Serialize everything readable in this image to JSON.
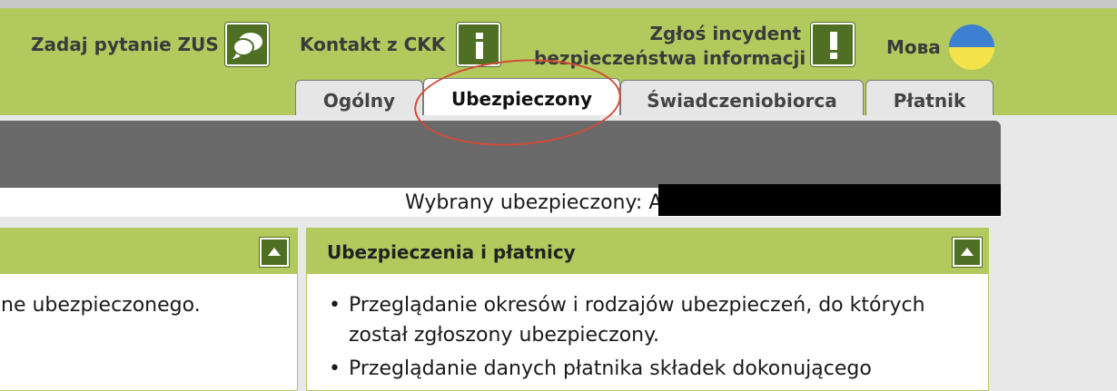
{
  "header": {
    "ask_zus": "Zadaj pytanie ZUS",
    "contact_ckk": "Kontakt z CKK",
    "report_line1": "Zgłoś incydent",
    "report_line2": "bezpieczeństwa informacji",
    "language": "Мова",
    "icons": [
      "chat-icon",
      "info-icon",
      "exclamation-icon",
      "ukraine-flag-icon"
    ]
  },
  "tabs": [
    {
      "label": "Ogólny",
      "active": false
    },
    {
      "label": "Ubezpieczony",
      "active": true
    },
    {
      "label": "Świadczeniobiorca",
      "active": false
    },
    {
      "label": "Płatnik",
      "active": false
    }
  ],
  "selected": {
    "label": "Wybrany ubezpieczony:",
    "value_visible": "A"
  },
  "left_panel": {
    "text": "ne ubezpieczonego."
  },
  "right_panel": {
    "title": "Ubezpieczenia i płatnicy",
    "items": [
      "Przeglądanie okresów i rodzajów ubezpieczeń, do których został zgłoszony ubezpieczony.",
      "Przeglądanie danych płatnika składek dokonującego"
    ]
  },
  "colors": {
    "header_green": "#b2c95d",
    "button_green": "#4e6f24",
    "gray_bar": "#6a6a6a",
    "annotation_red": "#d24a38"
  }
}
